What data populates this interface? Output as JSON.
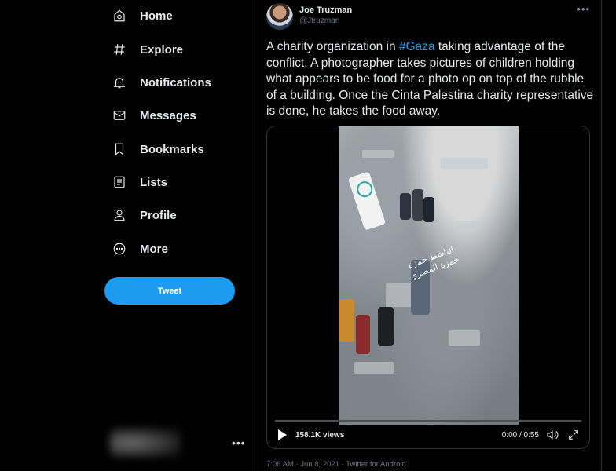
{
  "nav": {
    "items": [
      {
        "label": "Home",
        "icon": "home-icon"
      },
      {
        "label": "Explore",
        "icon": "hashtag-icon"
      },
      {
        "label": "Notifications",
        "icon": "bell-icon"
      },
      {
        "label": "Messages",
        "icon": "envelope-icon"
      },
      {
        "label": "Bookmarks",
        "icon": "bookmark-icon"
      },
      {
        "label": "Lists",
        "icon": "list-icon"
      },
      {
        "label": "Profile",
        "icon": "person-icon"
      },
      {
        "label": "More",
        "icon": "more-circle-icon"
      }
    ],
    "tweet_button": "Tweet",
    "account_more": "•••"
  },
  "tweet": {
    "author_name": "Joe Truzman",
    "author_handle": "@Jtruzman",
    "more": "•••",
    "text_before": "A charity organization in ",
    "hashtag": "#Gaza",
    "text_after": " taking advantage of the conflict. A photographer takes pictures of children holding what appears to be food for a photo op on top of the rubble of a building. Once the Cinta Palestina charity representative is done, he takes the food away.",
    "video": {
      "overlay_text": "الناشط حمزة حمزة المصري",
      "views": "158.1K views",
      "time": "0:00 / 0:55",
      "progress": 0
    },
    "meta": "7:06 AM · Jun 8, 2021 · Twitter for Android"
  },
  "colors": {
    "accent": "#1d9bf0",
    "background": "#000000",
    "border": "#2f3336"
  }
}
